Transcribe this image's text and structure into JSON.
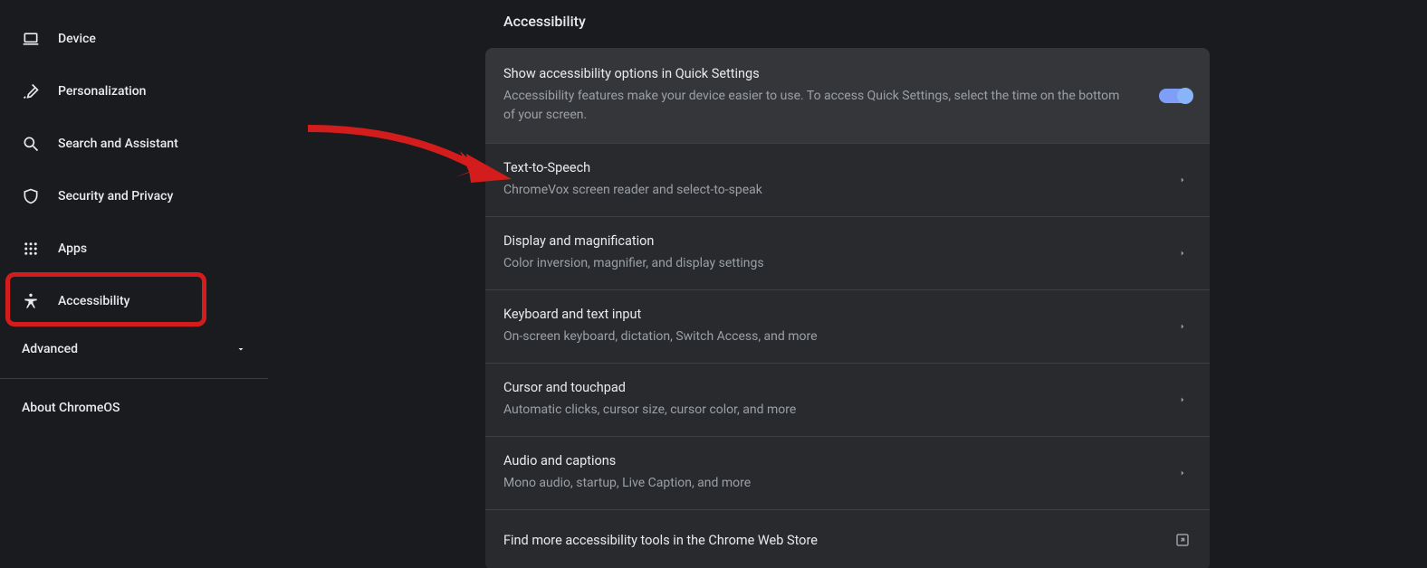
{
  "sidebar": {
    "items": [
      {
        "label": "Device",
        "icon": "laptop-icon"
      },
      {
        "label": "Personalization",
        "icon": "brush-icon"
      },
      {
        "label": "Search and Assistant",
        "icon": "search-icon"
      },
      {
        "label": "Security and Privacy",
        "icon": "shield-icon"
      },
      {
        "label": "Apps",
        "icon": "apps-grid-icon"
      },
      {
        "label": "Accessibility",
        "icon": "accessibility-icon"
      }
    ],
    "advanced_label": "Advanced",
    "about_label": "About ChromeOS"
  },
  "page": {
    "title": "Accessibility"
  },
  "rows": {
    "quick": {
      "title": "Show accessibility options in Quick Settings",
      "sub": "Accessibility features make your device easier to use. To access Quick Settings, select the time on the bottom of your screen.",
      "toggle_on": true
    },
    "tts": {
      "title": "Text-to-Speech",
      "sub": "ChromeVox screen reader and select-to-speak"
    },
    "display": {
      "title": "Display and magnification",
      "sub": "Color inversion, magnifier, and display settings"
    },
    "keyboard": {
      "title": "Keyboard and text input",
      "sub": "On-screen keyboard, dictation, Switch Access, and more"
    },
    "cursor": {
      "title": "Cursor and touchpad",
      "sub": "Automatic clicks, cursor size, cursor color, and more"
    },
    "audio": {
      "title": "Audio and captions",
      "sub": "Mono audio, startup, Live Caption, and more"
    },
    "webstore": {
      "title": "Find more accessibility tools in the Chrome Web Store"
    }
  }
}
